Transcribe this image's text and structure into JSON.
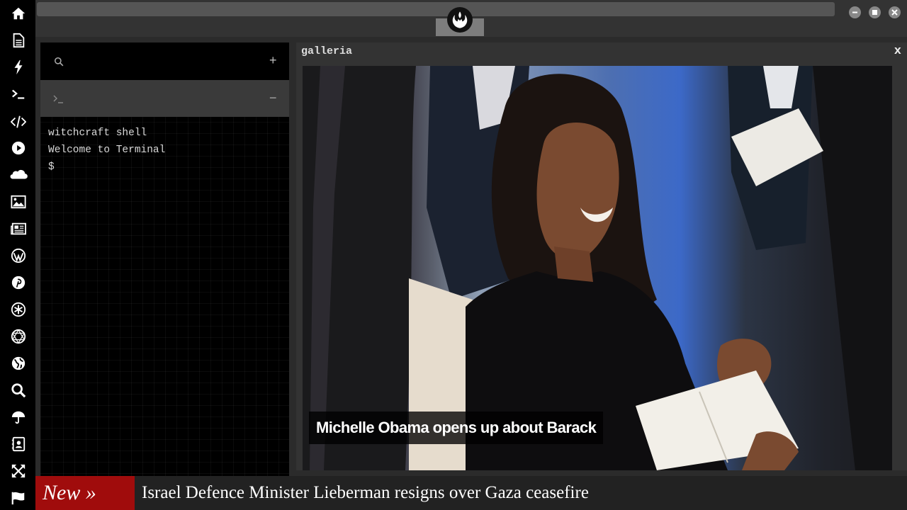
{
  "sidebar": {
    "items": [
      {
        "icon": "home-icon"
      },
      {
        "icon": "document-icon"
      },
      {
        "icon": "lightning-icon"
      },
      {
        "icon": "terminal-icon"
      },
      {
        "icon": "code-icon"
      },
      {
        "icon": "play-icon"
      },
      {
        "icon": "cloud-icon"
      },
      {
        "icon": "image-icon"
      },
      {
        "icon": "newspaper-icon"
      },
      {
        "icon": "wordpress-icon"
      },
      {
        "icon": "pinterest-icon"
      },
      {
        "icon": "snowflake-icon"
      },
      {
        "icon": "network-icon"
      },
      {
        "icon": "globe-icon"
      },
      {
        "icon": "search-icon"
      },
      {
        "icon": "umbrella-icon"
      },
      {
        "icon": "contact-book-icon"
      },
      {
        "icon": "expand-icon"
      },
      {
        "icon": "flag-icon"
      }
    ]
  },
  "window_controls": {
    "minimize_icon": "minimize-icon",
    "maximize_icon": "maximize-icon",
    "close_icon": "close-icon"
  },
  "logo": {
    "icon": "rebel-alliance-icon"
  },
  "terminal": {
    "search_icon": "search-icon",
    "add_label": "+",
    "tab_icon": "terminal-prompt-icon",
    "tab_close_label": "−",
    "lines": [
      "witchcraft shell",
      "Welcome to Terminal",
      "$"
    ]
  },
  "gallery": {
    "title": "galleria",
    "close_label": "x",
    "caption": "Michelle Obama opens up about Barack"
  },
  "ticker": {
    "badge": "New »",
    "headline": "Israel Defence Minister Lieberman resigns over Gaza ceasefire"
  },
  "colors": {
    "sidebar_bg": "#000000",
    "ticker_badge": "#a00c0c",
    "panel_bg": "#333333"
  }
}
